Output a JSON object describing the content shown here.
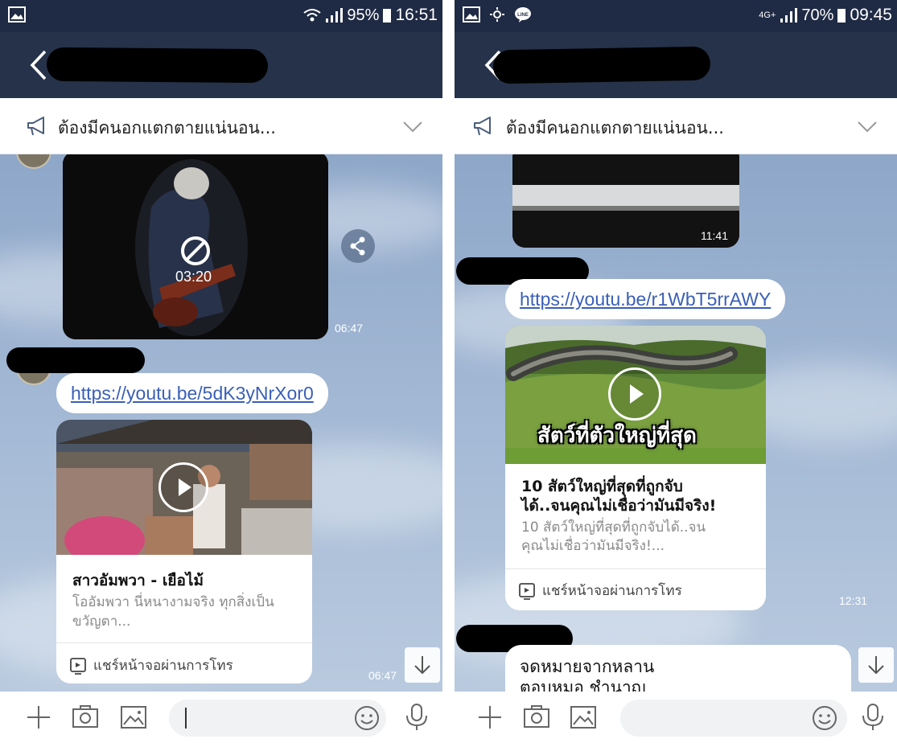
{
  "left": {
    "status": {
      "battery": "95%",
      "time": "16:51"
    },
    "announcement": "ต้องมีคนอกแตกตายแน่นอน...",
    "video": {
      "duration": "03:20",
      "time": "06:47"
    },
    "link": {
      "url": "https://youtu.be/5dK3yNrXor0"
    },
    "card": {
      "title": "สาวอัมพวา - เยือไม้",
      "desc_line1": "โออัมพวา นี่หนางามจริง ทุกสิ่งเป็น",
      "desc_line2": "ขวัญตา...",
      "share_label": "แชร์หน้าจอผ่านการโทร",
      "time": "06:47"
    }
  },
  "right": {
    "status": {
      "network": "4G+",
      "battery": "70%",
      "time": "09:45"
    },
    "announcement": "ต้องมีคนอกแตกตายแน่นอน...",
    "video": {
      "time": "11:41"
    },
    "link": {
      "url": "https://youtu.be/r1WbT5rrAWY"
    },
    "card": {
      "thumb_caption": "สัตว์ที่ตัวใหญ่ที่สุด",
      "title_line1": "10  สัตว์ใหญ่ที่สุดที่ถูกจับ",
      "title_line2": "ได้..จนคุณไม่เชื่อว่ามันมีจริง!",
      "desc_line1": "10  สัตว์ใหญ่ที่สุดที่ถูกจับได้..จน",
      "desc_line2": "คุณไม่เชื่อว่ามันมีจริง!...",
      "share_label": "แชร์หน้าจอผ่านการโทร",
      "time": "12:31"
    },
    "text_message": {
      "line1": "จดหมายจากหลาน",
      "line2": "ตอบหมอ ชำนาญ"
    }
  },
  "icons": [
    "image-icon",
    "wifi-icon",
    "signal-icon",
    "battery-icon",
    "back-icon",
    "search-icon",
    "phone-icon",
    "menu-icon",
    "megaphone-icon",
    "chevron-down-icon",
    "block-icon",
    "share-icon",
    "play-icon",
    "screen-share-icon",
    "arrow-down-icon",
    "plus-icon",
    "camera-icon",
    "gallery-icon",
    "emoji-icon",
    "mic-icon",
    "line-app-icon",
    "chat-bubble-icon",
    "dots-icon"
  ],
  "colors": {
    "header": "#263249",
    "chat_bg": "#a6bbd6",
    "link": "#3a5fb8"
  }
}
